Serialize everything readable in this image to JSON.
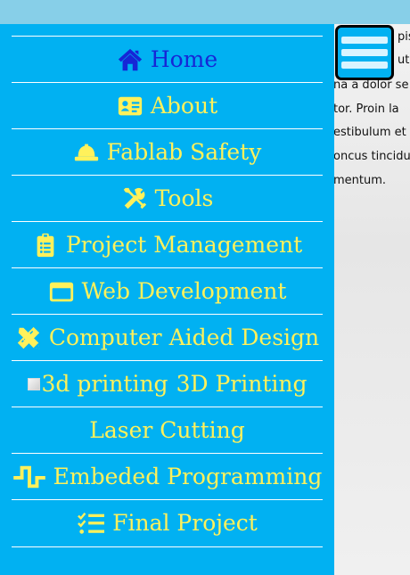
{
  "menu": {
    "items": [
      {
        "label": "Home",
        "icon": "home-icon",
        "active": true
      },
      {
        "label": "About",
        "icon": "id-card-icon",
        "active": false
      },
      {
        "label": "Fablab Safety",
        "icon": "hard-hat-icon",
        "active": false
      },
      {
        "label": "Tools",
        "icon": "tools-icon",
        "active": false
      },
      {
        "label": "Project Management",
        "icon": "clipboard-icon",
        "active": false
      },
      {
        "label": "Web Development",
        "icon": "browser-window-icon",
        "active": false
      },
      {
        "label": "Computer Aided Design",
        "icon": "pencil-ruler-icon",
        "active": false
      },
      {
        "label": "3D Printing",
        "icon": "broken-image-icon",
        "image_alt": "3d printing",
        "active": false
      },
      {
        "label": "Laser Cutting",
        "icon": "",
        "active": false
      },
      {
        "label": "Embeded Programming",
        "icon": "square-wave-icon",
        "active": false
      },
      {
        "label": "Final Project",
        "icon": "checklist-icon",
        "active": false
      }
    ]
  },
  "background_text": {
    "lines": [
      "pis",
      "utp",
      "na a dolor se",
      "tor. Proin la",
      "estibulum et",
      "oncus tincidu",
      "mentum."
    ]
  },
  "colors": {
    "sidebar_bg": "#01b1f2",
    "menu_text": "#fff15b",
    "active_text": "#1626d6",
    "divider": "#ffffff",
    "topbar": "#87cfe8"
  }
}
